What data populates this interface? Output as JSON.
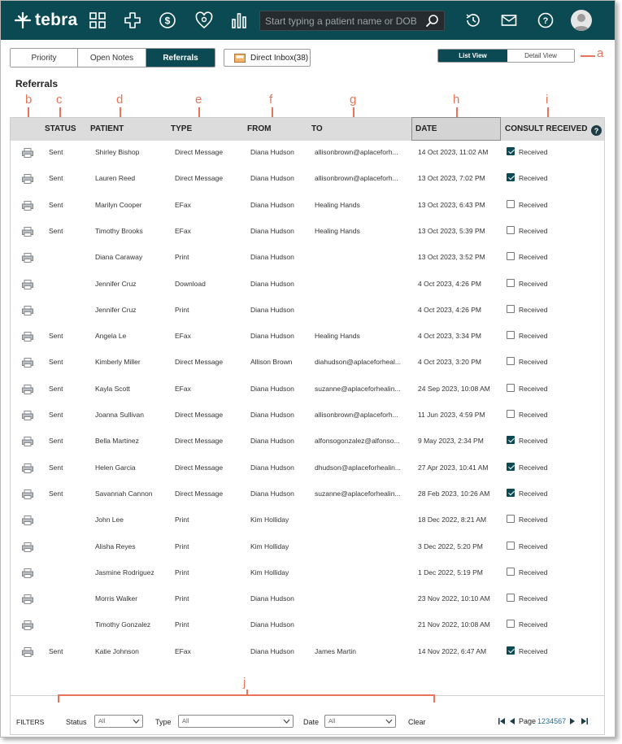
{
  "app": {
    "logo_text": "tebra"
  },
  "nav": {
    "search_placeholder": "Start typing a patient name or DOB",
    "icons": [
      "grid-icon",
      "plus-icon",
      "dollar-icon",
      "heart-icon",
      "bar-chart-icon",
      "history-icon",
      "mail-icon",
      "help-icon",
      "avatar"
    ]
  },
  "tabs": [
    {
      "label": "Priority",
      "active": false
    },
    {
      "label": "Open Notes",
      "active": false
    },
    {
      "label": "Referrals",
      "active": true
    }
  ],
  "inbox": {
    "label": "Direct Inbox(38)"
  },
  "view_toggle": [
    {
      "label": "List View",
      "active": true
    },
    {
      "label": "Detail View",
      "active": false
    }
  ],
  "page_title": "Referrals",
  "annotations": {
    "a": "a",
    "b": "b",
    "c": "c",
    "d": "d",
    "e": "e",
    "f": "f",
    "g": "g",
    "h": "h",
    "i": "i",
    "j": "j"
  },
  "table": {
    "headers": {
      "status": "STATUS",
      "patient": "PATIENT",
      "type": "TYPE",
      "from": "FROM",
      "to": "TO",
      "date": "DATE",
      "consult": "CONSULT RECEIVED"
    },
    "received_label": "Received",
    "rows": [
      {
        "status": "Sent",
        "patient": "Shirley Bishop",
        "type": "Direct Message",
        "from": "Diana Hudson",
        "to": "allisonbrown@aplaceforh...",
        "date": "14 Oct 2023, 11:02 AM",
        "received": true
      },
      {
        "status": "Sent",
        "patient": "Lauren Reed",
        "type": "Direct Message",
        "from": "Diana Hudson",
        "to": "allisonbrown@aplaceforh...",
        "date": "13 Oct 2023, 7:02 PM",
        "received": true
      },
      {
        "status": "Sent",
        "patient": "Marilyn Cooper",
        "type": "EFax",
        "from": "Diana Hudson",
        "to": "Healing Hands",
        "date": "13 Oct 2023, 6:43 PM",
        "received": false
      },
      {
        "status": "Sent",
        "patient": "Timothy Brooks",
        "type": "EFax",
        "from": "Diana Hudson",
        "to": "Healing Hands",
        "date": "13 Oct 2023, 5:39 PM",
        "received": false
      },
      {
        "status": "",
        "patient": "Diana Caraway",
        "type": "Print",
        "from": "Diana Hudson",
        "to": "",
        "date": "13 Oct 2023, 3:52 PM",
        "received": false
      },
      {
        "status": "",
        "patient": "Jennifer Cruz",
        "type": "Download",
        "from": "Diana Hudson",
        "to": "",
        "date": "4 Oct 2023, 4:26 PM",
        "received": false
      },
      {
        "status": "",
        "patient": "Jennifer Cruz",
        "type": "Print",
        "from": "Diana Hudson",
        "to": "",
        "date": "4 Oct 2023, 4:26 PM",
        "received": false
      },
      {
        "status": "Sent",
        "patient": "Angela Le",
        "type": "EFax",
        "from": "Diana Hudson",
        "to": "Healing Hands",
        "date": "4 Oct 2023, 3:34 PM",
        "received": false
      },
      {
        "status": "Sent",
        "patient": "Kimberly Miller",
        "type": "Direct Message",
        "from": "Allison Brown",
        "to": "diahudson@aplaceforheal...",
        "date": "4 Oct 2023, 3:20 PM",
        "received": false
      },
      {
        "status": "Sent",
        "patient": "Kayla Scott",
        "type": "EFax",
        "from": "Diana Hudson",
        "to": "suzanne@aplaceforhealin...",
        "date": "24 Sep 2023, 10:08 AM",
        "received": false
      },
      {
        "status": "Sent",
        "patient": "Joanna Sullivan",
        "type": "Direct Message",
        "from": "Diana Hudson",
        "to": "allisonbrown@aplaceforh...",
        "date": "11 Jun 2023, 4:59 PM",
        "received": false
      },
      {
        "status": "Sent",
        "patient": "Bella Martinez",
        "type": "Direct Message",
        "from": "Diana Hudson",
        "to": "alfonsogonzalez@alfonso...",
        "date": "9 May 2023, 2:34 PM",
        "received": true
      },
      {
        "status": "Sent",
        "patient": "Helen Garcia",
        "type": "Direct Message",
        "from": "Diana Hudson",
        "to": "dhudson@aplaceforhealin...",
        "date": "27 Apr 2023, 10:41 AM",
        "received": true
      },
      {
        "status": "Sent",
        "patient": "Savannah Cannon",
        "type": "Direct Message",
        "from": "Diana Hudson",
        "to": "suzanne@aplaceforhealin...",
        "date": "28 Feb 2023, 10:26 AM",
        "received": true
      },
      {
        "status": "",
        "patient": "John Lee",
        "type": "Print",
        "from": "Kim Holliday",
        "to": "",
        "date": "18 Dec 2022, 8:21 AM",
        "received": false
      },
      {
        "status": "",
        "patient": "Alisha Reyes",
        "type": "Print",
        "from": "Kim Holliday",
        "to": "",
        "date": "3 Dec 2022, 5:20 PM",
        "received": false
      },
      {
        "status": "",
        "patient": "Jasmine Rodriguez",
        "type": "Print",
        "from": "Kim Holliday",
        "to": "",
        "date": "1 Dec 2022, 5:19 PM",
        "received": false
      },
      {
        "status": "",
        "patient": "Morris Walker",
        "type": "Print",
        "from": "Diana Hudson",
        "to": "",
        "date": "23 Nov 2022, 10:10 AM",
        "received": false
      },
      {
        "status": "",
        "patient": "Timothy Gonzalez",
        "type": "Print",
        "from": "Diana Hudson",
        "to": "",
        "date": "21 Nov 2022, 10:08 AM",
        "received": false
      },
      {
        "status": "Sent",
        "patient": "Katie Johnson",
        "type": "EFax",
        "from": "Diana Hudson",
        "to": "James Martin",
        "date": "14 Nov 2022, 6:47 AM",
        "received": true
      }
    ]
  },
  "filters": {
    "title": "FILTERS",
    "status_label": "Status",
    "status_value": "All",
    "type_label": "Type",
    "type_value": "All",
    "date_label": "Date",
    "date_value": "All",
    "clear_label": "Clear"
  },
  "pager": {
    "label": "Page",
    "pages": [
      "1",
      "2",
      "3",
      "4",
      "5",
      "6",
      "7"
    ]
  }
}
